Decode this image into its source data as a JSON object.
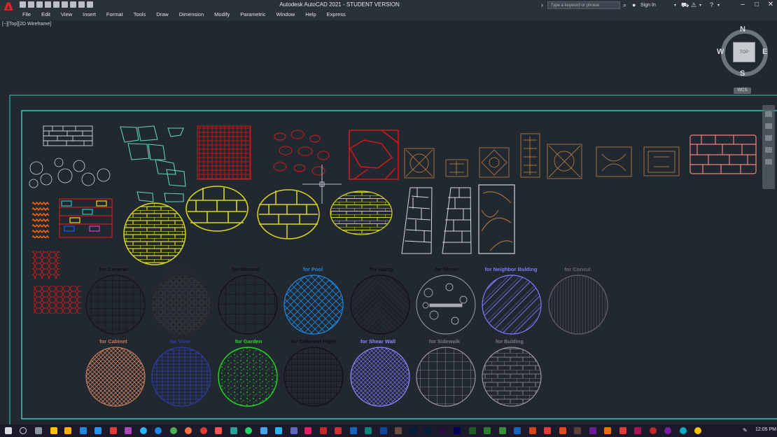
{
  "app": {
    "logo": "A",
    "title": "Autodesk AutoCAD 2021 - STUDENT VERSION",
    "search_placeholder": "Type a keyword or phrase",
    "sign_in": "Sign In"
  },
  "menu": [
    "File",
    "Edit",
    "View",
    "Insert",
    "Format",
    "Tools",
    "Draw",
    "Dimension",
    "Modify",
    "Parametric",
    "Window",
    "Help",
    "Express"
  ],
  "viewport_label": "[−][Top][2D Wireframe]",
  "viewcube": {
    "top": "TOP",
    "north": "N",
    "south": "S",
    "east": "E",
    "west": "W",
    "wcs": "WCS"
  },
  "hatch_labels_row1": [
    {
      "text": "for Ceramic",
      "color": "#111111"
    },
    {
      "text": "for Mosaic",
      "color": "#2a2a2a"
    },
    {
      "text": "for Ground",
      "color": "#111111"
    },
    {
      "text": "for Pool",
      "color": "#1e88e5"
    },
    {
      "text": "for Ramp",
      "color": "#111111"
    },
    {
      "text": "for Street",
      "color": "#111111"
    },
    {
      "text": "for Neighbor Bulding",
      "color": "#7c7cff"
    },
    {
      "text": "for Consul",
      "color": "#6a6a6a"
    }
  ],
  "hatch_labels_row2": [
    {
      "text": "for Cabinet",
      "color": "#c97858"
    },
    {
      "text": "for View",
      "color": "#2a3ea8"
    },
    {
      "text": "for Garden",
      "color": "#22dd22"
    },
    {
      "text": "for Different Hight",
      "color": "#111111"
    },
    {
      "text": "for Shear Wall",
      "color": "#8a8aff"
    },
    {
      "text": "for Sidewalk",
      "color": "#7a7a7a"
    },
    {
      "text": "for Bulding",
      "color": "#7a7a7a"
    }
  ],
  "taskbar": {
    "clock": "12:05 PM"
  },
  "colors": {
    "background": "#212830",
    "frame": "#37c9bd",
    "red_pattern": "#d11a1a",
    "yellow_pattern": "#d7d71e",
    "brown_pattern": "#a0713e",
    "teal_pattern": "#5fd3b0",
    "pink_pattern": "#f08080"
  }
}
